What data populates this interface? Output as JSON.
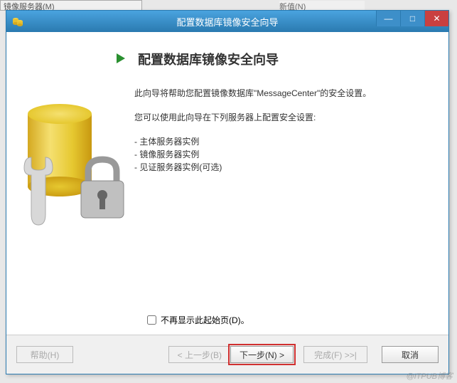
{
  "background": {
    "partial_text_left": "镜像服务器(M)",
    "partial_text_right": "新值(N)"
  },
  "titlebar": {
    "title": "配置数据库镜像安全向导"
  },
  "win_controls": {
    "minimize": "—",
    "maximize": "□",
    "close": "✕"
  },
  "page": {
    "heading": "配置数据库镜像安全向导",
    "intro1": "此向导将帮助您配置镜像数据库\"MessageCenter\"的安全设置。",
    "intro2": "您可以使用此向导在下列服务器上配置安全设置:",
    "servers": [
      "- 主体服务器实例",
      "- 镜像服务器实例",
      "- 见证服务器实例(可选)"
    ],
    "dont_show_label": "不再显示此起始页(D)。"
  },
  "footer": {
    "help": "帮助(H)",
    "back": "< 上一步(B)",
    "next": "下一步(N) >",
    "finish": "完成(F) >>|",
    "cancel": "取消"
  },
  "watermark": "@ITPUB博客"
}
